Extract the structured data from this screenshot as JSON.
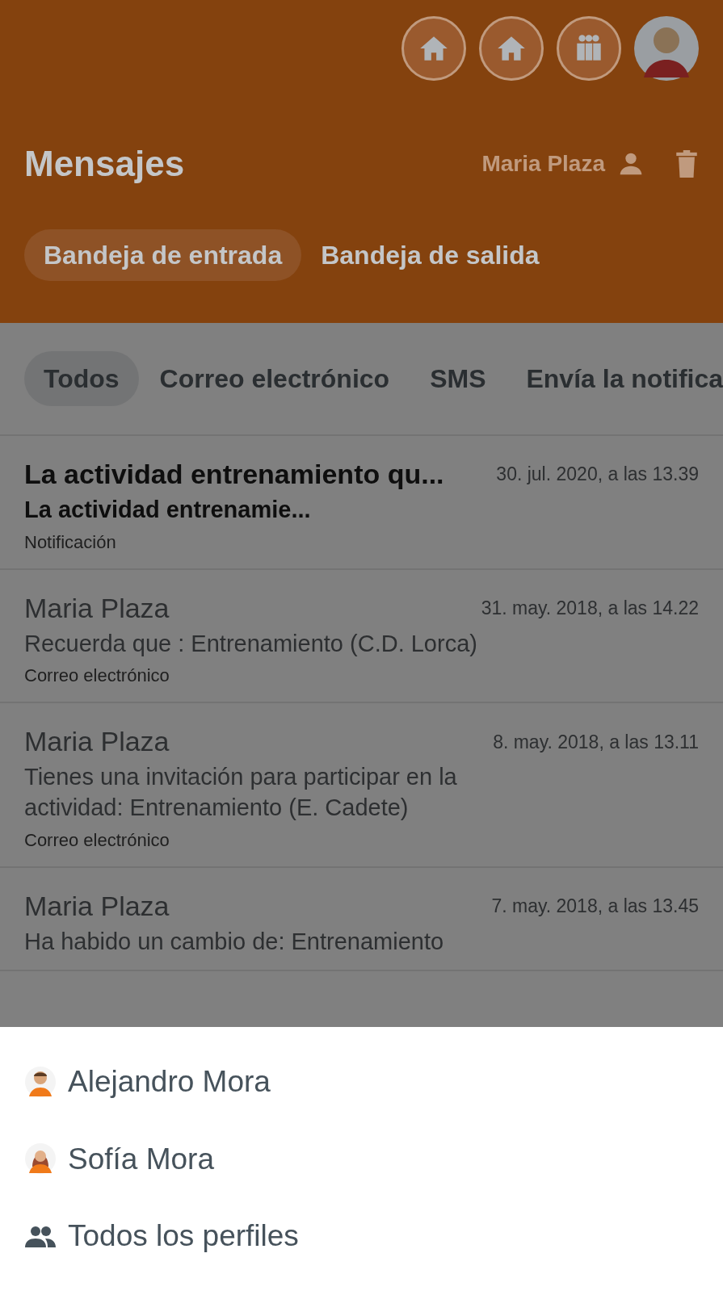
{
  "header": {
    "icons": [
      {
        "kind": "home"
      },
      {
        "kind": "home"
      },
      {
        "kind": "group"
      },
      {
        "kind": "avatar"
      }
    ],
    "title": "Mensajes",
    "user": "Maria Plaza"
  },
  "folder_tabs": [
    {
      "label": "Bandeja de entrada",
      "selected": true
    },
    {
      "label": "Bandeja de salida",
      "selected": false
    }
  ],
  "filter_tabs": [
    {
      "label": "Todos",
      "selected": true
    },
    {
      "label": "Correo electrónico",
      "selected": false
    },
    {
      "label": "SMS",
      "selected": false
    },
    {
      "label": "Envía la notifica",
      "selected": false
    }
  ],
  "messages": [
    {
      "sender": "La actividad entrenamiento qu...",
      "date": "30. jul. 2020, a las 13.39",
      "body": "La actividad entrenamie...",
      "type": "Notificación",
      "unread": true
    },
    {
      "sender": "Maria Plaza",
      "date": "31. may. 2018, a las 14.22",
      "body": "Recuerda que : Entrenamiento (C.D. Lorca)",
      "type": "Correo electrónico",
      "unread": false
    },
    {
      "sender": "Maria Plaza",
      "date": "8. may. 2018, a las 13.11",
      "body": "Tienes una invitación para participar en la actividad: Entrenamiento (E. Cadete)",
      "type": "Correo electrónico",
      "unread": false
    },
    {
      "sender": "Maria Plaza",
      "date": "7. may. 2018, a las 13.45",
      "body": "Ha habido un cambio de: Entrenamiento",
      "unread": false
    }
  ],
  "profile_sheet": [
    {
      "name": "Alejandro Mora",
      "kind": "boy"
    },
    {
      "name": "Sofía Mora",
      "kind": "girl"
    },
    {
      "name": "Todos los perfiles",
      "kind": "all"
    }
  ]
}
